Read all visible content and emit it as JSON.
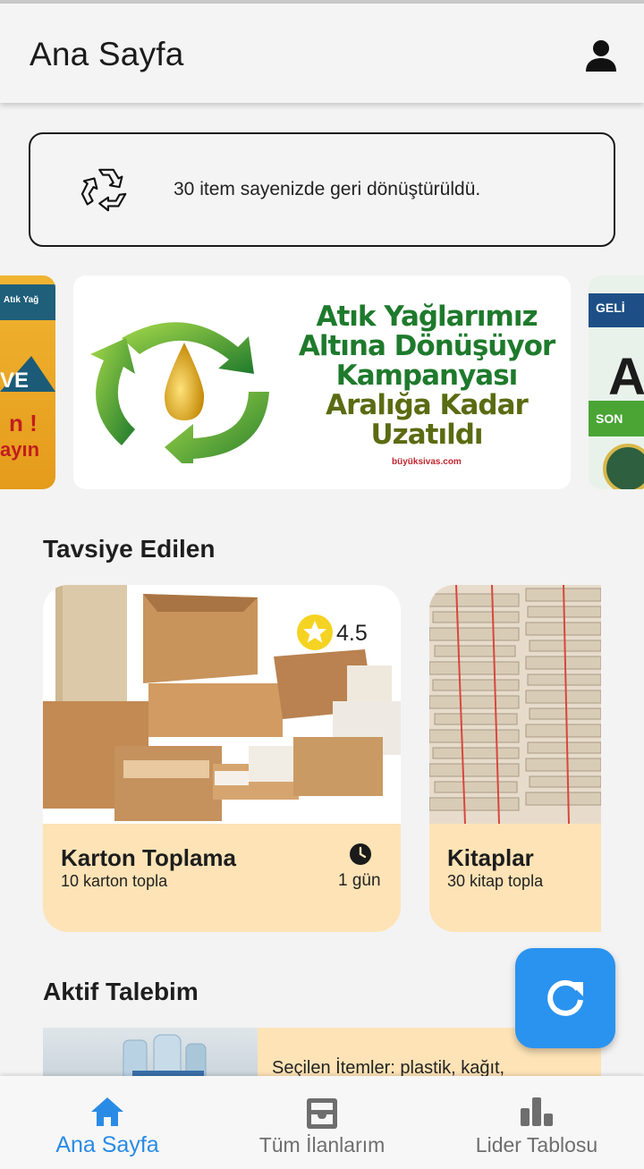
{
  "appbar": {
    "title": "Ana Sayfa",
    "account_icon": "person-icon"
  },
  "stats": {
    "icon": "recycle-icon",
    "text": "30 item sayenizde geri dönüştürüldü."
  },
  "banners": {
    "main": {
      "line1": "Atık Yağlarımız",
      "line2": "Altına Dönüşüyor",
      "line3": "Kampanyası",
      "line4": "Aralığa Kadar",
      "line5": "Uzatıldı",
      "source": "büyüksivas.com"
    },
    "left": {
      "t1": "Atık Yağ",
      "t2": "VE",
      "t3": "n !",
      "t4": "ayın"
    },
    "right": {
      "t1": "GELİ",
      "t2": "SON"
    }
  },
  "recommended": {
    "title": "Tavsiye Edilen",
    "items": [
      {
        "name": "Karton Toplama",
        "desc": "10 karton topla",
        "duration": "1 gün",
        "rating": "4.5"
      },
      {
        "name": "Kitaplar",
        "desc": "30 kitap topla"
      }
    ]
  },
  "active": {
    "title": "Aktif Talebim",
    "text": "Seçilen İtemler: plastik, kağıt,"
  },
  "fab": {
    "icon": "refresh-icon"
  },
  "nav": {
    "items": [
      {
        "label": "Ana Sayfa",
        "icon": "home-icon"
      },
      {
        "label": "Tüm İlanlarım",
        "icon": "inbox-icon"
      },
      {
        "label": "Lider Tablosu",
        "icon": "bar-chart-icon"
      }
    ]
  },
  "colors": {
    "accent": "#2a93ef",
    "card": "#fde3b6",
    "background": "#f3f3f3",
    "star": "#f5d322"
  }
}
